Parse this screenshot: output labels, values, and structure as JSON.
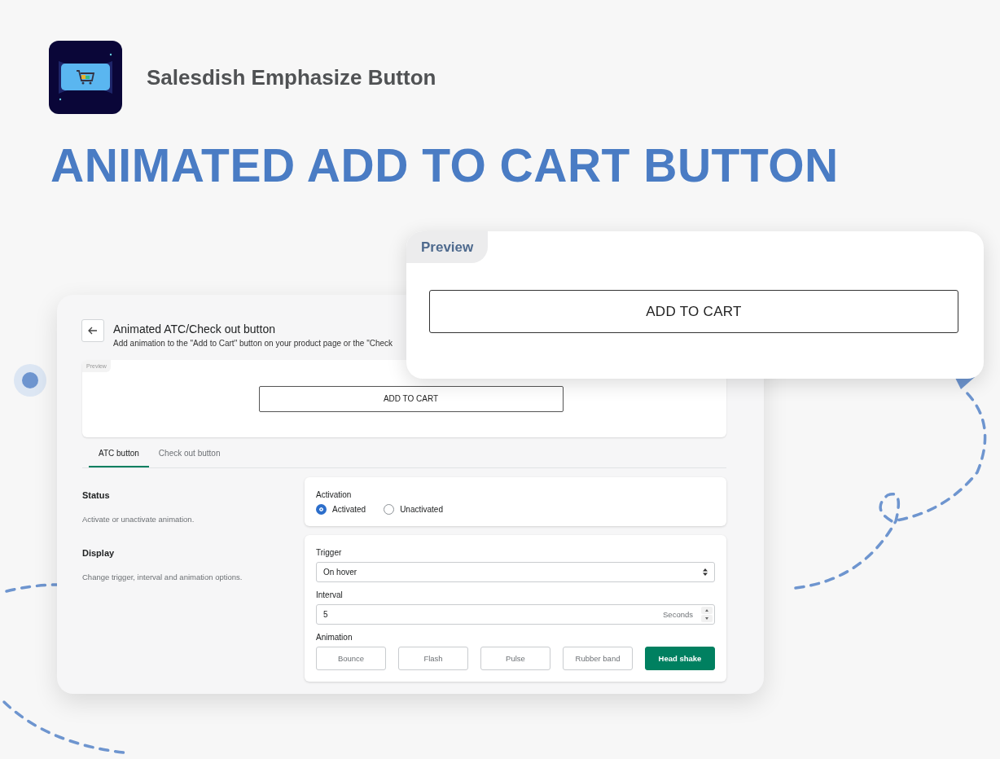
{
  "app": {
    "name": "Salesdish Emphasize Button"
  },
  "headline": "ANIMATED ADD TO CART BUTTON",
  "settings_card": {
    "title": "Animated ATC/Check out button",
    "description": "Add animation to the \"Add to Cart\" button on your product page or the \"Check",
    "preview": {
      "label": "Preview",
      "button": "ADD TO CART"
    },
    "tabs": [
      {
        "label": "ATC button",
        "selected": true
      },
      {
        "label": "Check out button",
        "selected": false
      }
    ],
    "status": {
      "title": "Status",
      "description": "Activate or unactivate animation.",
      "field_label": "Activation",
      "options": [
        {
          "label": "Activated",
          "selected": true
        },
        {
          "label": "Unactivated",
          "selected": false
        }
      ]
    },
    "display": {
      "title": "Display",
      "description": "Change trigger, interval and animation options.",
      "trigger": {
        "label": "Trigger",
        "value": "On hover"
      },
      "interval": {
        "label": "Interval",
        "value": "5",
        "unit": "Seconds"
      },
      "animation": {
        "label": "Animation",
        "options": [
          {
            "label": "Bounce",
            "selected": false
          },
          {
            "label": "Flash",
            "selected": false
          },
          {
            "label": "Pulse",
            "selected": false
          },
          {
            "label": "Rubber band",
            "selected": false
          },
          {
            "label": "Head shake",
            "selected": true
          }
        ]
      }
    }
  },
  "zoomed_preview": {
    "label": "Preview",
    "button": "ADD TO CART"
  }
}
